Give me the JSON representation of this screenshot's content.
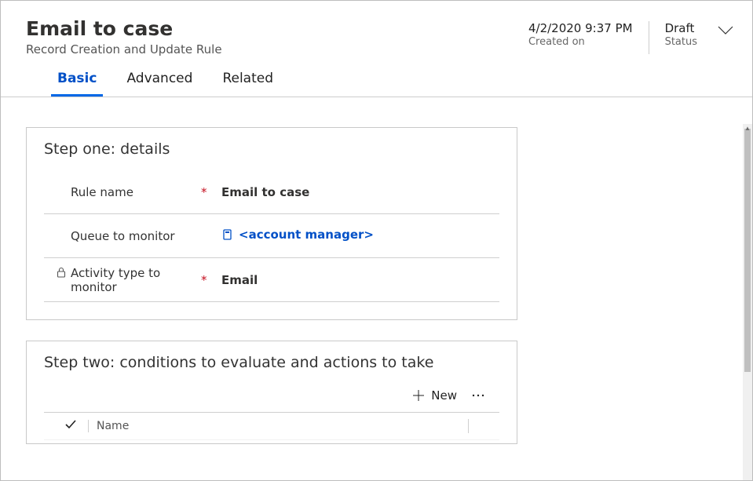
{
  "header": {
    "title": "Email to case",
    "subtitle": "Record Creation and Update Rule",
    "created_value": "4/2/2020 9:37 PM",
    "created_label": "Created on",
    "status_value": "Draft",
    "status_label": "Status"
  },
  "tabs": {
    "basic": "Basic",
    "advanced": "Advanced",
    "related": "Related"
  },
  "step_one": {
    "title": "Step one: details",
    "fields": {
      "rule_name": {
        "label": "Rule name",
        "required": "*",
        "value": "Email to case"
      },
      "queue": {
        "label": "Queue to monitor",
        "required": "",
        "value": "<account manager>"
      },
      "activity": {
        "label": "Activity type to monitor",
        "required": "*",
        "value": "Email"
      }
    }
  },
  "step_two": {
    "title": "Step two: conditions to evaluate and actions to take",
    "toolbar": {
      "new": "New"
    },
    "columns": {
      "name": "Name"
    }
  }
}
